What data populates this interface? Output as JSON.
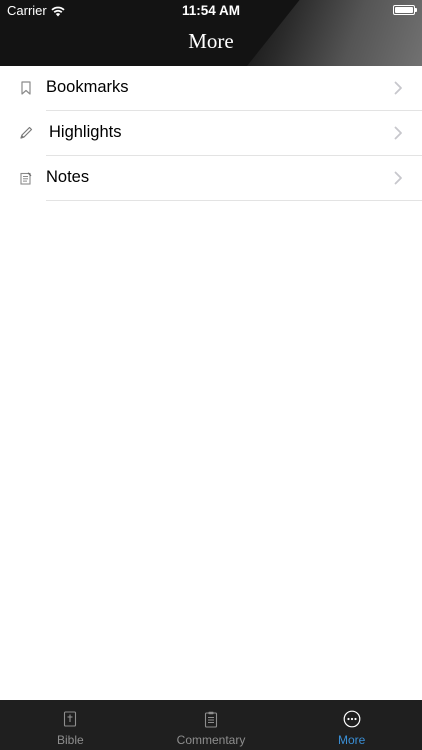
{
  "status_bar": {
    "carrier": "Carrier",
    "time": "11:54 AM"
  },
  "nav": {
    "title": "More"
  },
  "list": {
    "items": [
      {
        "label": "Bookmarks",
        "icon": "bookmark-icon"
      },
      {
        "label": "Highlights",
        "icon": "pencil-icon"
      },
      {
        "label": "Notes",
        "icon": "note-icon"
      }
    ]
  },
  "tabbar": {
    "tabs": [
      {
        "label": "Bible",
        "icon": "bible-icon",
        "active": false
      },
      {
        "label": "Commentary",
        "icon": "commentary-icon",
        "active": false
      },
      {
        "label": "More",
        "icon": "more-icon",
        "active": true
      }
    ]
  },
  "colors": {
    "header_bg": "#131313",
    "tabbar_bg": "#1f1f1f",
    "tab_active": "#3a8fd6",
    "tab_inactive": "#8e8e8e",
    "divider": "#e3e3e3"
  }
}
